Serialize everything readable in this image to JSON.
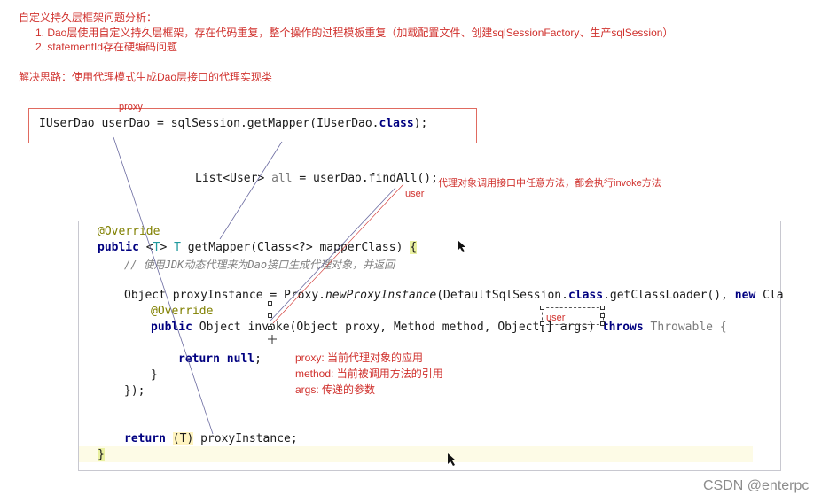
{
  "notes": {
    "heading": "自定义持久层框架问题分析：",
    "items": [
      "1.  Dao层使用自定义持久层框架，存在代码重复，整个操作的过程模板重复（加载配置文件、创建sqlSessionFactory、生产sqlSession）",
      "2.  statementId存在硬编码问题"
    ],
    "solution": "解决思路：使用代理模式生成Dao层接口的代理实现类"
  },
  "snippet_top": {
    "label": "proxy",
    "p1": "IUserDao userDao = sqlSession.getMapper(IUserDao.",
    "kw": "class",
    "p2": ");"
  },
  "snippet_mid": {
    "p1": "List<User> ",
    "var": "all",
    "p2": " = userDao.findAll();",
    "note": "代理对象调用接口中任意方法，都会执行invoke方法",
    "user_label": "user"
  },
  "code": {
    "override1": "@Override",
    "l2_kw": "public",
    "l2_a": " <",
    "l2_T1": "T",
    "l2_b": "> ",
    "l2_T2": "T",
    "l2_c": " getMapper(Class<?> mapperClass) ",
    "l2_brace": "{",
    "comment_a": "// 使用",
    "comment_jdk": "JDK",
    "comment_b": "动态代理来为",
    "comment_dao": "Dao",
    "comment_c": "接口生成代理对象，并返回",
    "l4_a": "Object proxyInstance = Proxy.",
    "l4_m": "newProxyInstance",
    "l4_b": "(DefaultSqlSession.",
    "l4_kw": "class",
    "l4_c": ".getClassLoader(), ",
    "l4_kw2": "new",
    "l4_d": " Cla",
    "override2": "@Override",
    "l6_kw": "public",
    "l6_a": " Object invoke(Object proxy, Method method, Object[] args) ",
    "l6_kw2": "throws",
    "l6_b": " Throwable {",
    "l7_kw": "return",
    "l7_kw2": "null",
    "l7_a": ";",
    "l8": "}",
    "l9": "});",
    "l10_kw": "return",
    "l10_p": "(T)",
    "l10_a": " proxyInstance;",
    "l11": "}"
  },
  "annotations": {
    "user_inline": "user",
    "params": [
      "proxy: 当前代理对象的应用",
      "method: 当前被调用方法的引用",
      "args: 传递的参数"
    ]
  },
  "watermark": "CSDN @enterpc",
  "colors": {
    "note_red": "#d0312d",
    "keyword": "#000080",
    "annotation": "#808000"
  }
}
